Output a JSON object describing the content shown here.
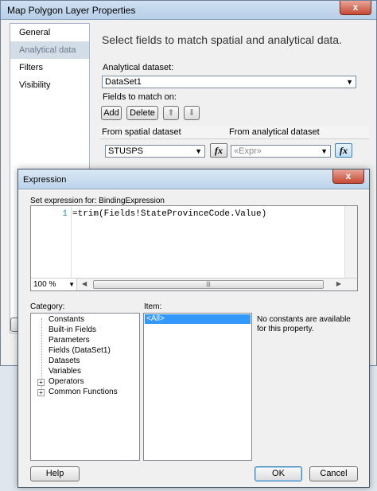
{
  "main_window": {
    "title": "Map Polygon Layer Properties",
    "close_glyph": "x",
    "nav": [
      {
        "label": "General",
        "selected": false
      },
      {
        "label": "Analytical data",
        "selected": true
      },
      {
        "label": "Filters",
        "selected": false
      },
      {
        "label": "Visibility",
        "selected": false
      }
    ],
    "heading": "Select fields to match spatial and analytical data.",
    "analytical_dataset_label": "Analytical dataset:",
    "analytical_dataset_value": "DataSet1",
    "fields_label": "Fields to match on:",
    "add_label": "Add",
    "delete_label": "Delete",
    "col_spatial": "From spatial dataset",
    "col_analytical": "From analytical dataset",
    "spatial_value": "STUSPS",
    "analytical_value": "«Expr»"
  },
  "expression_dialog": {
    "title": "Expression",
    "close_glyph": "x",
    "set_expression_label": "Set expression for: BindingExpression",
    "line_number": "1",
    "code": "=trim(Fields!StateProvinceCode.Value)",
    "zoom": "100 %",
    "category_label": "Category:",
    "item_label": "Item:",
    "categories": [
      {
        "label": "Constants",
        "expandable": false
      },
      {
        "label": "Built-in Fields",
        "expandable": false
      },
      {
        "label": "Parameters",
        "expandable": false
      },
      {
        "label": "Fields (DataSet1)",
        "expandable": false
      },
      {
        "label": "Datasets",
        "expandable": false
      },
      {
        "label": "Variables",
        "expandable": false
      },
      {
        "label": "Operators",
        "expandable": true
      },
      {
        "label": "Common Functions",
        "expandable": true
      }
    ],
    "items": [
      "<All>"
    ],
    "description": "No constants are available for this property.",
    "help_label": "Help",
    "ok_label": "OK",
    "cancel_label": "Cancel"
  },
  "colors": {
    "selection": "#3399ff",
    "titlebar": "#bcd3ea",
    "close_button": "#c54a34"
  }
}
